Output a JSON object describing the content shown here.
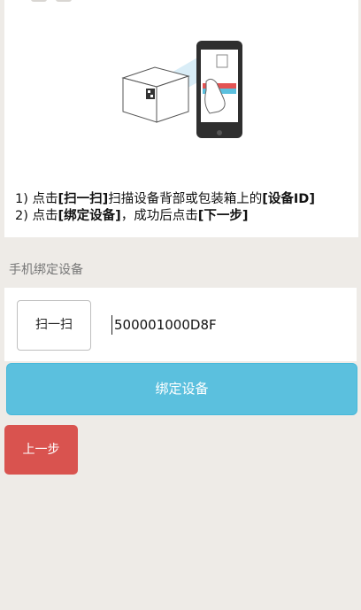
{
  "instructions": {
    "line1_a": "1) 点击",
    "line1_b": "[扫一扫]",
    "line1_c": "扫描设备背部或包装箱上的",
    "line1_d": "[设备ID]",
    "line2_a": "2) 点击",
    "line2_b": "[绑定设备]",
    "line2_c": "，成功后点击",
    "line2_d": "[下一步]"
  },
  "section": {
    "title": "手机绑定设备"
  },
  "bind_form": {
    "scan_label": "扫一扫",
    "device_id_value": "500001000D8F"
  },
  "buttons": {
    "bind_label": "绑定设备",
    "prev_label": "上一步"
  },
  "colors": {
    "bind_button": "#5bc0de",
    "prev_button": "#d9534f",
    "page_background": "#eeebe7"
  }
}
